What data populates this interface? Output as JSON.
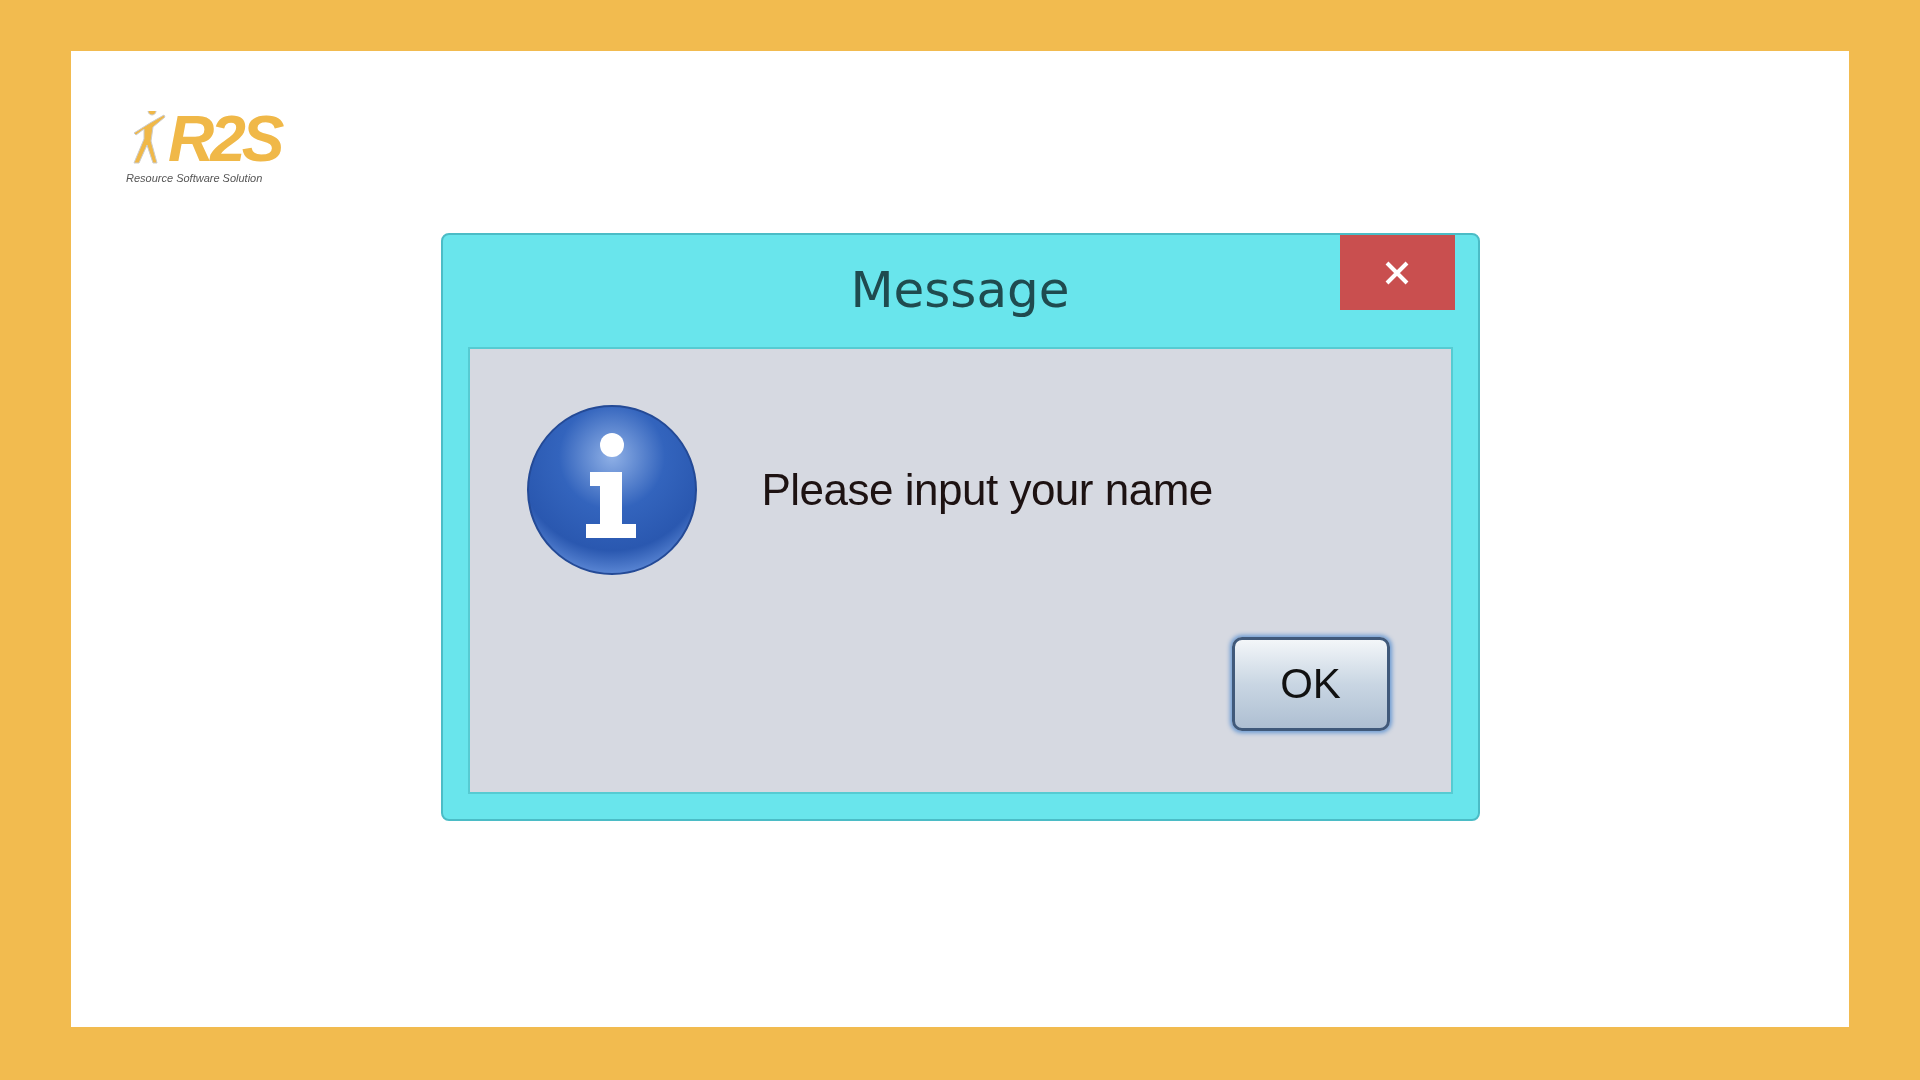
{
  "logo": {
    "mark": "R2S",
    "tagline": "Resource Software Solution"
  },
  "dialog": {
    "title": "Message",
    "message": "Please input your name",
    "buttons": [
      {
        "label": "OK"
      }
    ]
  }
}
